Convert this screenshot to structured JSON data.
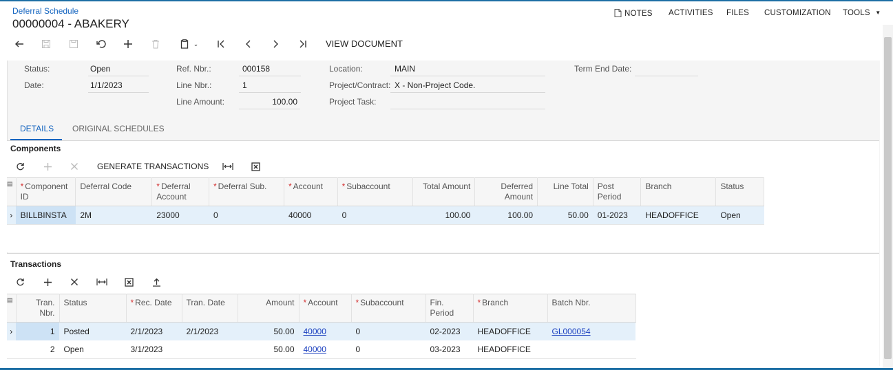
{
  "header": {
    "breadcrumb": "Deferral Schedule",
    "title": "00000004 - ABAKERY",
    "nav": {
      "notes": "NOTES",
      "activities": "ACTIVITIES",
      "files": "FILES",
      "customization": "CUSTOMIZATION",
      "tools": "TOOLS"
    }
  },
  "toolbar": {
    "view_document": "VIEW DOCUMENT"
  },
  "form": {
    "status_label": "Status:",
    "status_value": "Open",
    "date_label": "Date:",
    "date_value": "1/1/2023",
    "ref_label": "Ref. Nbr.:",
    "ref_value": "000158",
    "line_nbr_label": "Line Nbr.:",
    "line_nbr_value": "1",
    "line_amount_label": "Line Amount:",
    "line_amount_value": "100.00",
    "location_label": "Location:",
    "location_value": "MAIN",
    "project_label": "Project/Contract:",
    "project_value": "X - Non-Project Code.",
    "task_label": "Project Task:",
    "task_value": "",
    "term_end_label": "Term End Date:",
    "term_end_value": ""
  },
  "tabs": {
    "details": "DETAILS",
    "original": "ORIGINAL SCHEDULES"
  },
  "components": {
    "heading": "Components",
    "generate_label": "GENERATE TRANSACTIONS",
    "columns": {
      "component_id": "Component ID",
      "deferral_code": "Deferral Code",
      "deferral_account": "Deferral Account",
      "deferral_sub": "Deferral Sub.",
      "account": "Account",
      "subaccount": "Subaccount",
      "total_amount": "Total Amount",
      "deferred_amount": "Deferred Amount",
      "line_total": "Line Total",
      "post_period": "Post Period",
      "branch": "Branch",
      "status": "Status"
    },
    "rows": [
      {
        "component_id": "BILLBINSTA",
        "deferral_code": "2M",
        "deferral_account": "23000",
        "deferral_sub": "0",
        "account": "40000",
        "subaccount": "0",
        "total_amount": "100.00",
        "deferred_amount": "100.00",
        "line_total": "50.00",
        "post_period": "01-2023",
        "branch": "HEADOFFICE",
        "status": "Open"
      }
    ]
  },
  "transactions": {
    "heading": "Transactions",
    "columns": {
      "tran_nbr": "Tran. Nbr.",
      "status": "Status",
      "rec_date": "Rec. Date",
      "tran_date": "Tran. Date",
      "amount": "Amount",
      "account": "Account",
      "subaccount": "Subaccount",
      "fin_period": "Fin. Period",
      "branch": "Branch",
      "batch_nbr": "Batch Nbr."
    },
    "rows": [
      {
        "tran_nbr": "1",
        "status": "Posted",
        "rec_date": "2/1/2023",
        "tran_date": "2/1/2023",
        "amount": "50.00",
        "account": "40000",
        "subaccount": "0",
        "fin_period": "02-2023",
        "branch": "HEADOFFICE",
        "batch_nbr": "GL000054"
      },
      {
        "tran_nbr": "2",
        "status": "Open",
        "rec_date": "3/1/2023",
        "tran_date": "",
        "amount": "50.00",
        "account": "40000",
        "subaccount": "0",
        "fin_period": "03-2023",
        "branch": "HEADOFFICE",
        "batch_nbr": ""
      }
    ]
  }
}
